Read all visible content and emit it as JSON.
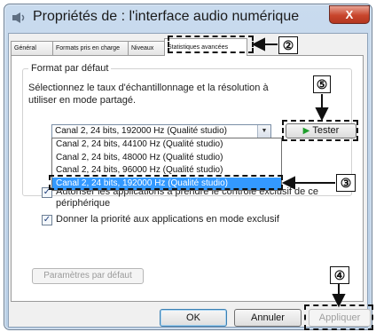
{
  "window": {
    "title": "Propriétés de : l'interface audio numérique",
    "close_label": "X"
  },
  "tabs": [
    {
      "label": "Général"
    },
    {
      "label": "Formats pris en charge"
    },
    {
      "label": "Niveaux"
    },
    {
      "label": "Statistiques avancées"
    }
  ],
  "default_format": {
    "legend": "Format par défaut",
    "description": "Sélectionnez le taux d'échantillonnage et la résolution à utiliser en mode partagé.",
    "selected_value": "Canal 2, 24 bits, 192000 Hz (Qualité studio)",
    "test_label": "Tester",
    "options": [
      "Canal 2, 24 bits, 44100 Hz (Qualité studio)",
      "Canal 2, 24 bits, 48000 Hz (Qualité studio)",
      "Canal 2, 24 bits, 96000 Hz (Qualité studio)",
      "Canal 2, 24 bits, 192000 Hz (Qualité studio)"
    ]
  },
  "exclusive_mode": {
    "allow_label": "Autoriser les applications à prendre le contrôle exclusif de ce périphérique",
    "allow_checked": true,
    "priority_label": "Donner la priorité aux applications en mode exclusif",
    "priority_checked": true
  },
  "buttons": {
    "defaults": "Paramètres par défaut",
    "ok": "OK",
    "cancel": "Annuler",
    "apply": "Appliquer"
  },
  "callouts": {
    "tab": "②",
    "dropdown": "③",
    "apply": "④",
    "test": "⑤"
  },
  "icons": {
    "title": "speaker-icon",
    "test": "play-icon",
    "dropdown": "chevron-down-icon",
    "check": "checkmark-icon"
  }
}
